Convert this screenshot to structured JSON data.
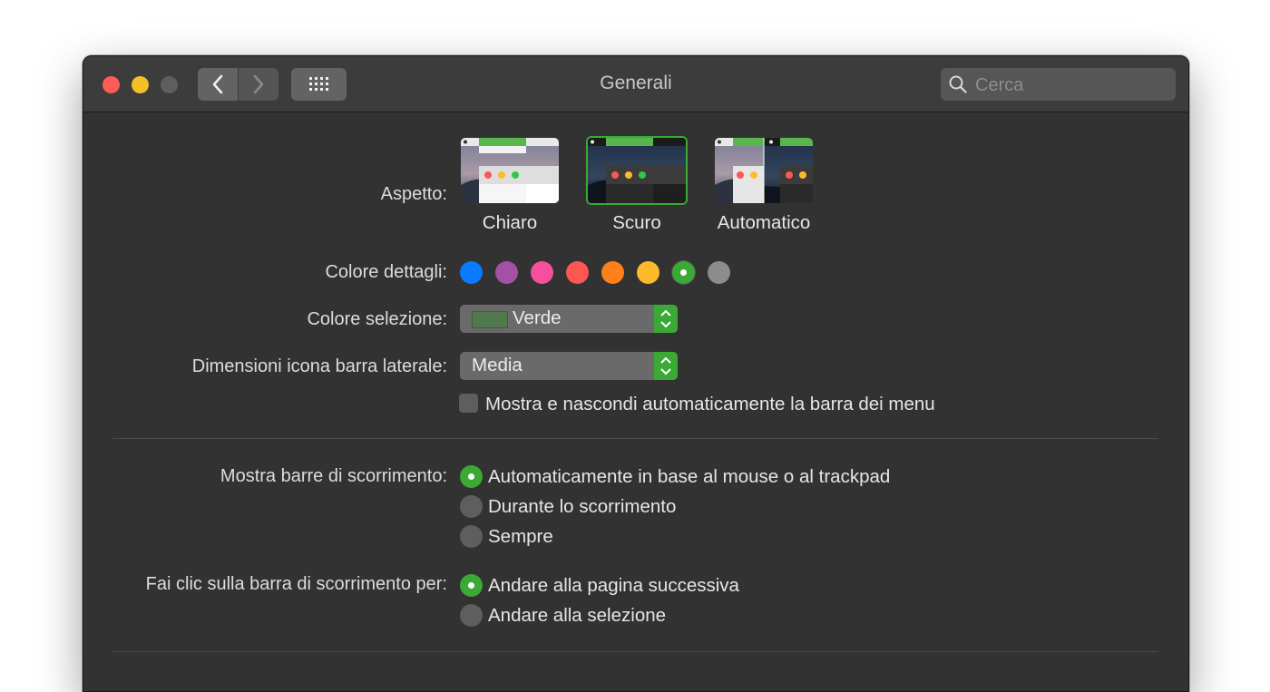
{
  "window": {
    "title": "Generali",
    "search_placeholder": "Cerca"
  },
  "appearance": {
    "label": "Aspetto:",
    "options": [
      {
        "label": "Chiaro",
        "selected": false
      },
      {
        "label": "Scuro",
        "selected": true
      },
      {
        "label": "Automatico",
        "selected": false
      }
    ]
  },
  "accent": {
    "label": "Colore dettagli:",
    "colors": [
      "#0a7aff",
      "#a550a7",
      "#f74f9e",
      "#fc5753",
      "#fd8018",
      "#fdba2c",
      "#3aaa35",
      "#8c8c8c"
    ],
    "selected_index": 6
  },
  "highlight": {
    "label": "Colore selezione:",
    "value": "Verde",
    "swatch_color": "#50784c"
  },
  "sidebar_icon": {
    "label": "Dimensioni icona barra laterale:",
    "value": "Media"
  },
  "menubar": {
    "label": "Mostra e nascondi automaticamente la barra dei menu",
    "checked": false
  },
  "scrollbars": {
    "label": "Mostra barre di scorrimento:",
    "options": [
      {
        "label": "Automaticamente in base al mouse o al trackpad",
        "selected": true
      },
      {
        "label": "Durante lo scorrimento",
        "selected": false
      },
      {
        "label": "Sempre",
        "selected": false
      }
    ]
  },
  "click_scroll": {
    "label": "Fai clic sulla barra di scorrimento per:",
    "options": [
      {
        "label": "Andare alla pagina successiva",
        "selected": true
      },
      {
        "label": "Andare alla selezione",
        "selected": false
      }
    ]
  },
  "colors": {
    "accent": "#3aaa35",
    "window_bg": "#323232",
    "titlebar_bg": "#3c3c3c"
  }
}
